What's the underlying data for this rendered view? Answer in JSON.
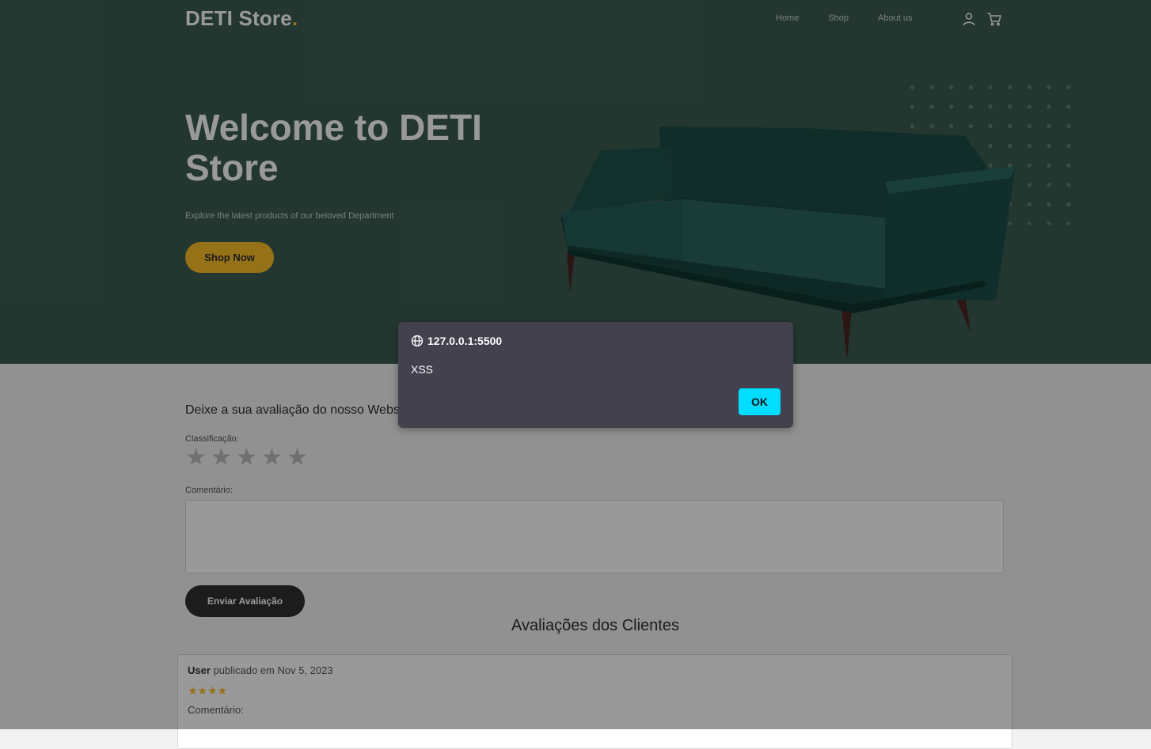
{
  "header": {
    "brand": "DETI Store",
    "brand_dot": ".",
    "nav": [
      "Home",
      "Shop",
      "About us"
    ],
    "icons": [
      "user-icon",
      "cart-icon"
    ]
  },
  "hero": {
    "title": "Welcome to DETI Store",
    "subtitle": "Explore the latest products of our beloved Department",
    "cta_label": "Shop Now",
    "image": "sofa-image"
  },
  "review_form": {
    "heading": "Deixe a sua avaliação do nosso Website",
    "rating_label": "Classificação:",
    "stars": [
      "★",
      "★",
      "★",
      "★",
      "★"
    ],
    "comment_label": "Comentário:",
    "comment_value": "",
    "submit_label": "Enviar Avaliação"
  },
  "reviews": {
    "heading": "Avaliações dos Clientes",
    "items": [
      {
        "user": "User",
        "published": "publicado em Nov 5, 2023",
        "stars": "★★★★",
        "rating": 4,
        "comment_label": "Comentário:"
      }
    ]
  },
  "alert": {
    "origin": "127.0.0.1:5500",
    "message": "XSS",
    "ok_label": "OK"
  },
  "colors": {
    "hero_bg": "#3b5d50",
    "accent": "#f9bf29",
    "dark_button": "#2f2f2f",
    "dialog_bg": "#42414d",
    "dialog_ok": "#00ddff"
  }
}
